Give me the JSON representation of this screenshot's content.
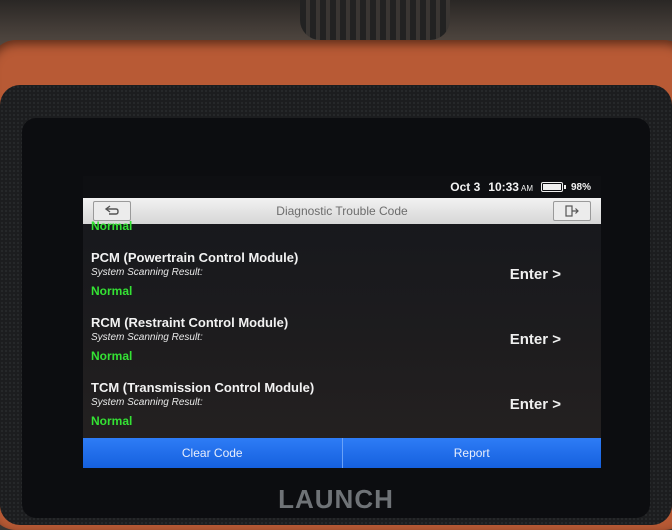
{
  "status_bar": {
    "date": "Oct 3",
    "time": "10:33",
    "ampm": "AM",
    "battery_percent": "98%",
    "battery_icon": "battery-icon"
  },
  "title_bar": {
    "title": "Diagnostic Trouble Code",
    "back_icon": "back-arrow-icon",
    "exit_icon": "exit-icon"
  },
  "partial_status": "Normal",
  "modules": [
    {
      "name": "PCM (Powertrain Control Module)",
      "scan_label": "System Scanning Result:",
      "status": "Normal",
      "enter_label": "Enter >"
    },
    {
      "name": "RCM (Restraint Control Module)",
      "scan_label": "System Scanning Result:",
      "status": "Normal",
      "enter_label": "Enter >"
    },
    {
      "name": "TCM (Transmission Control Module)",
      "scan_label": "System Scanning Result:",
      "status": "Normal",
      "enter_label": "Enter >"
    }
  ],
  "bottom_bar": {
    "clear_label": "Clear Code",
    "report_label": "Report"
  },
  "device_brand": "LAUNCH",
  "colors": {
    "accent_blue": "#1b6df0",
    "status_green": "#34e234",
    "device_orange": "#b85a35"
  }
}
